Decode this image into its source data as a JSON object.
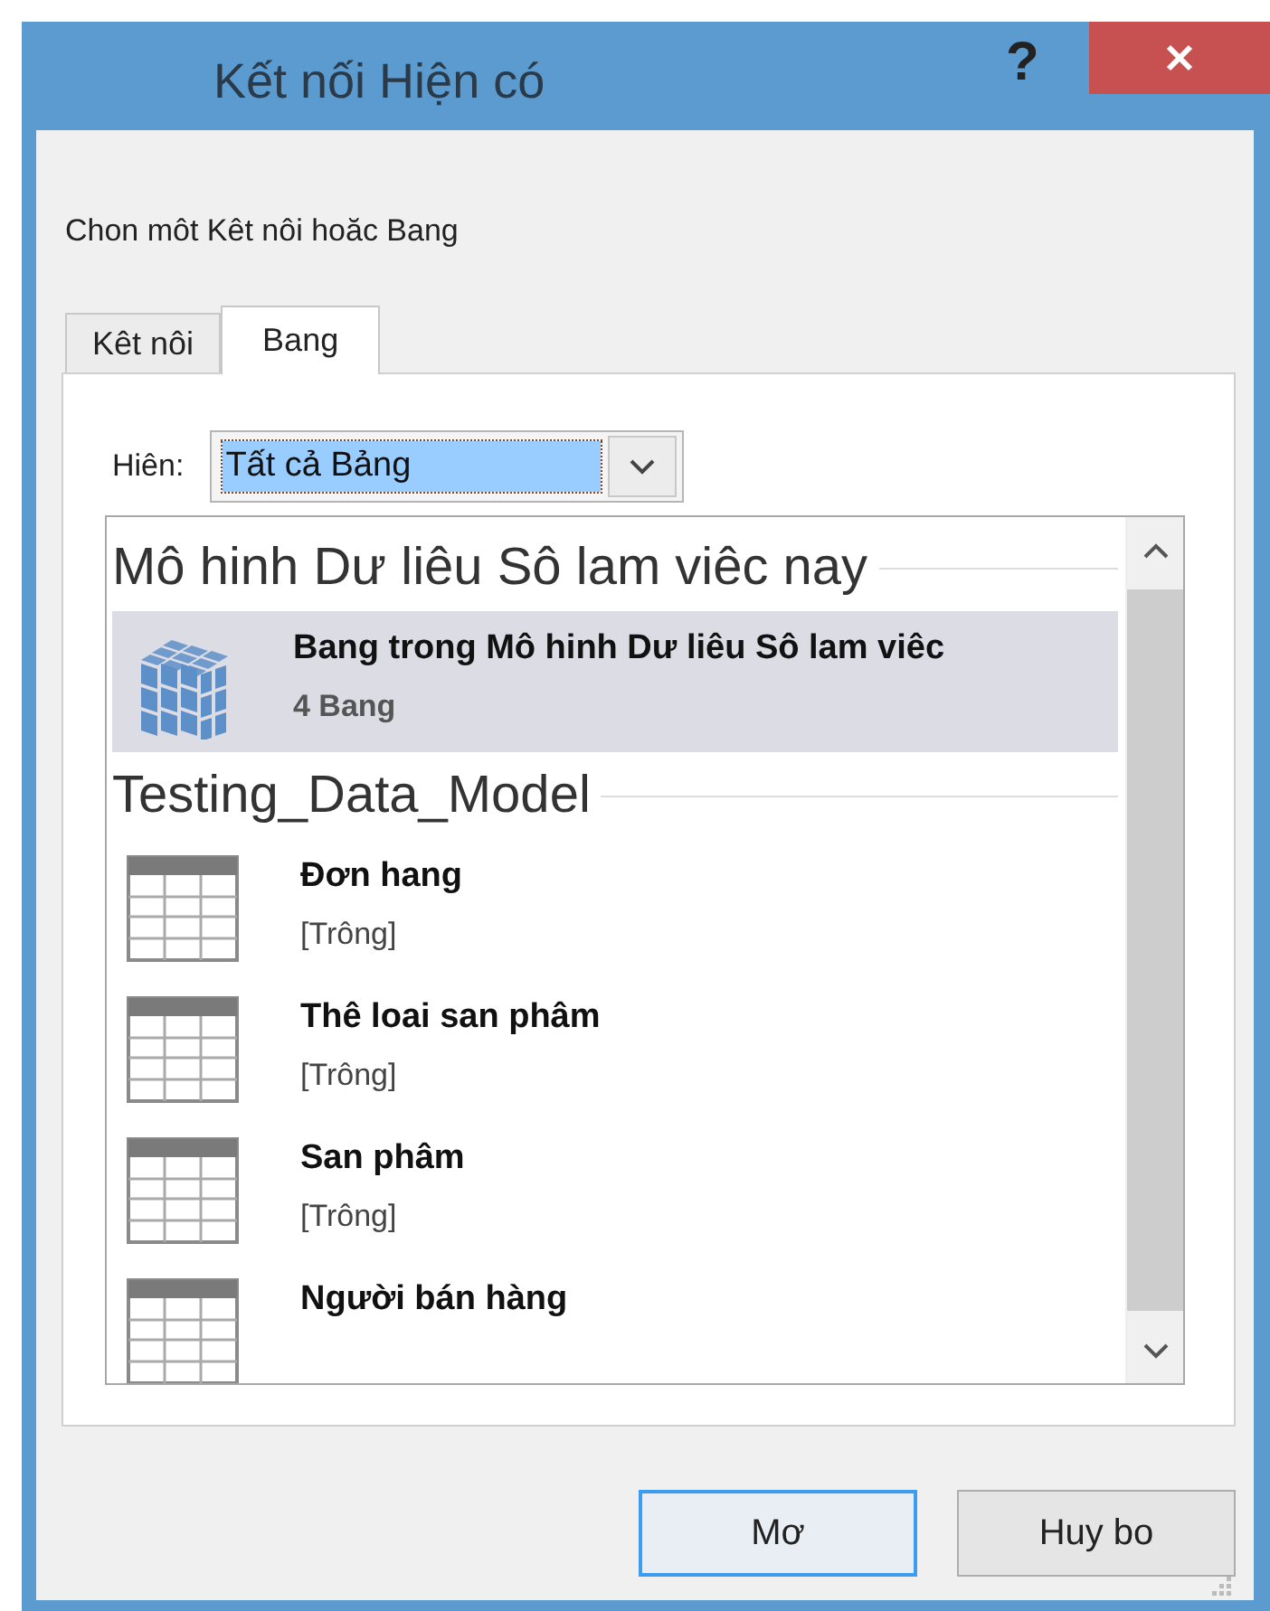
{
  "window": {
    "title": "Kết nối Hiện có",
    "help_button": "?"
  },
  "prompt": "Chon môt Kêt nôi hoăc Bang",
  "tabs": [
    {
      "label": "Kêt nôi",
      "selected": false
    },
    {
      "label": "Bang",
      "selected": true
    }
  ],
  "filter": {
    "label": "Hiên:",
    "value": "Tất cả Bảng"
  },
  "groups": [
    {
      "title": "Mô hinh Dư liêu Sô lam viêc nay",
      "items": [
        {
          "kind": "model",
          "name": "Bang trong Mô hinh Dư liêu Sô lam viêc",
          "detail": "4 Bang",
          "selected": true
        }
      ]
    },
    {
      "title": "Testing_Data_Model",
      "items": [
        {
          "kind": "table",
          "name": "Đơn hang",
          "detail": "[Trông]",
          "selected": false
        },
        {
          "kind": "table",
          "name": "Thê loai san phâm",
          "detail": "[Trông]",
          "selected": false
        },
        {
          "kind": "table",
          "name": "San phâm",
          "detail": "[Trông]",
          "selected": false
        },
        {
          "kind": "table",
          "name": "Người bán hàng",
          "selected": false
        }
      ]
    }
  ],
  "buttons": [
    {
      "label": "Mơ",
      "focused": true
    },
    {
      "label": "Huy bo",
      "focused": false
    }
  ]
}
